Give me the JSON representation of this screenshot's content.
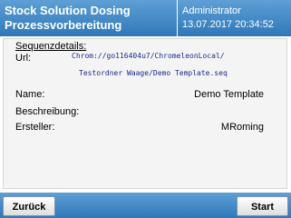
{
  "header": {
    "title_line1": "Stock Solution Dosing",
    "title_line2": "Prozessvorbereitung",
    "user": "Administrator",
    "datetime": "13.07.2017 20:34:52"
  },
  "details": {
    "section_title": "Sequenzdetails:",
    "url_label": "Url:",
    "url_line1": "Chrom://go116404u7/ChromeleonLocal/",
    "url_line2": "Testordner Waage/Demo Template.seq",
    "name_label": "Name:",
    "name_value": "Demo Template",
    "description_label": "Beschreibung:",
    "description_value": "",
    "creator_label": "Ersteller:",
    "creator_value": "MRoming"
  },
  "footer": {
    "back_label": "Zurück",
    "start_label": "Start"
  },
  "colors": {
    "header_top": "#5ea0d6",
    "header_bottom": "#2f77b8",
    "url_text": "#1b2a8f"
  }
}
